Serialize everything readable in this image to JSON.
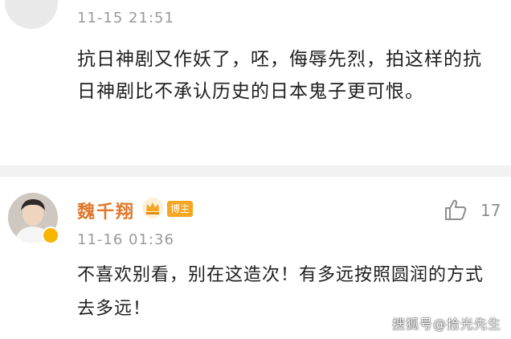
{
  "comments": [
    {
      "time": "11-15 21:51",
      "text": "抗日神剧又作妖了，呸，侮辱先烈，拍这样的抗日神剧比不承认历史的日本鬼子更可恨。"
    },
    {
      "username": "魏千翔",
      "badge": "博主",
      "likes": "17",
      "time": "11-16 01:36",
      "text": "不喜欢别看，别在这造次！有多远按照圆润的方式去多远！"
    }
  ],
  "watermark": "搜狐号@拾光先生",
  "colors": {
    "username": "#e0772a",
    "badge_bg": "#f6a623",
    "time": "#9a9a9a",
    "text": "#1e1e1e",
    "separator": "#f2f2f2"
  },
  "icons": {
    "crown": "crown-icon",
    "like": "thumbs-up-icon",
    "verified": "verified-badge-icon"
  }
}
